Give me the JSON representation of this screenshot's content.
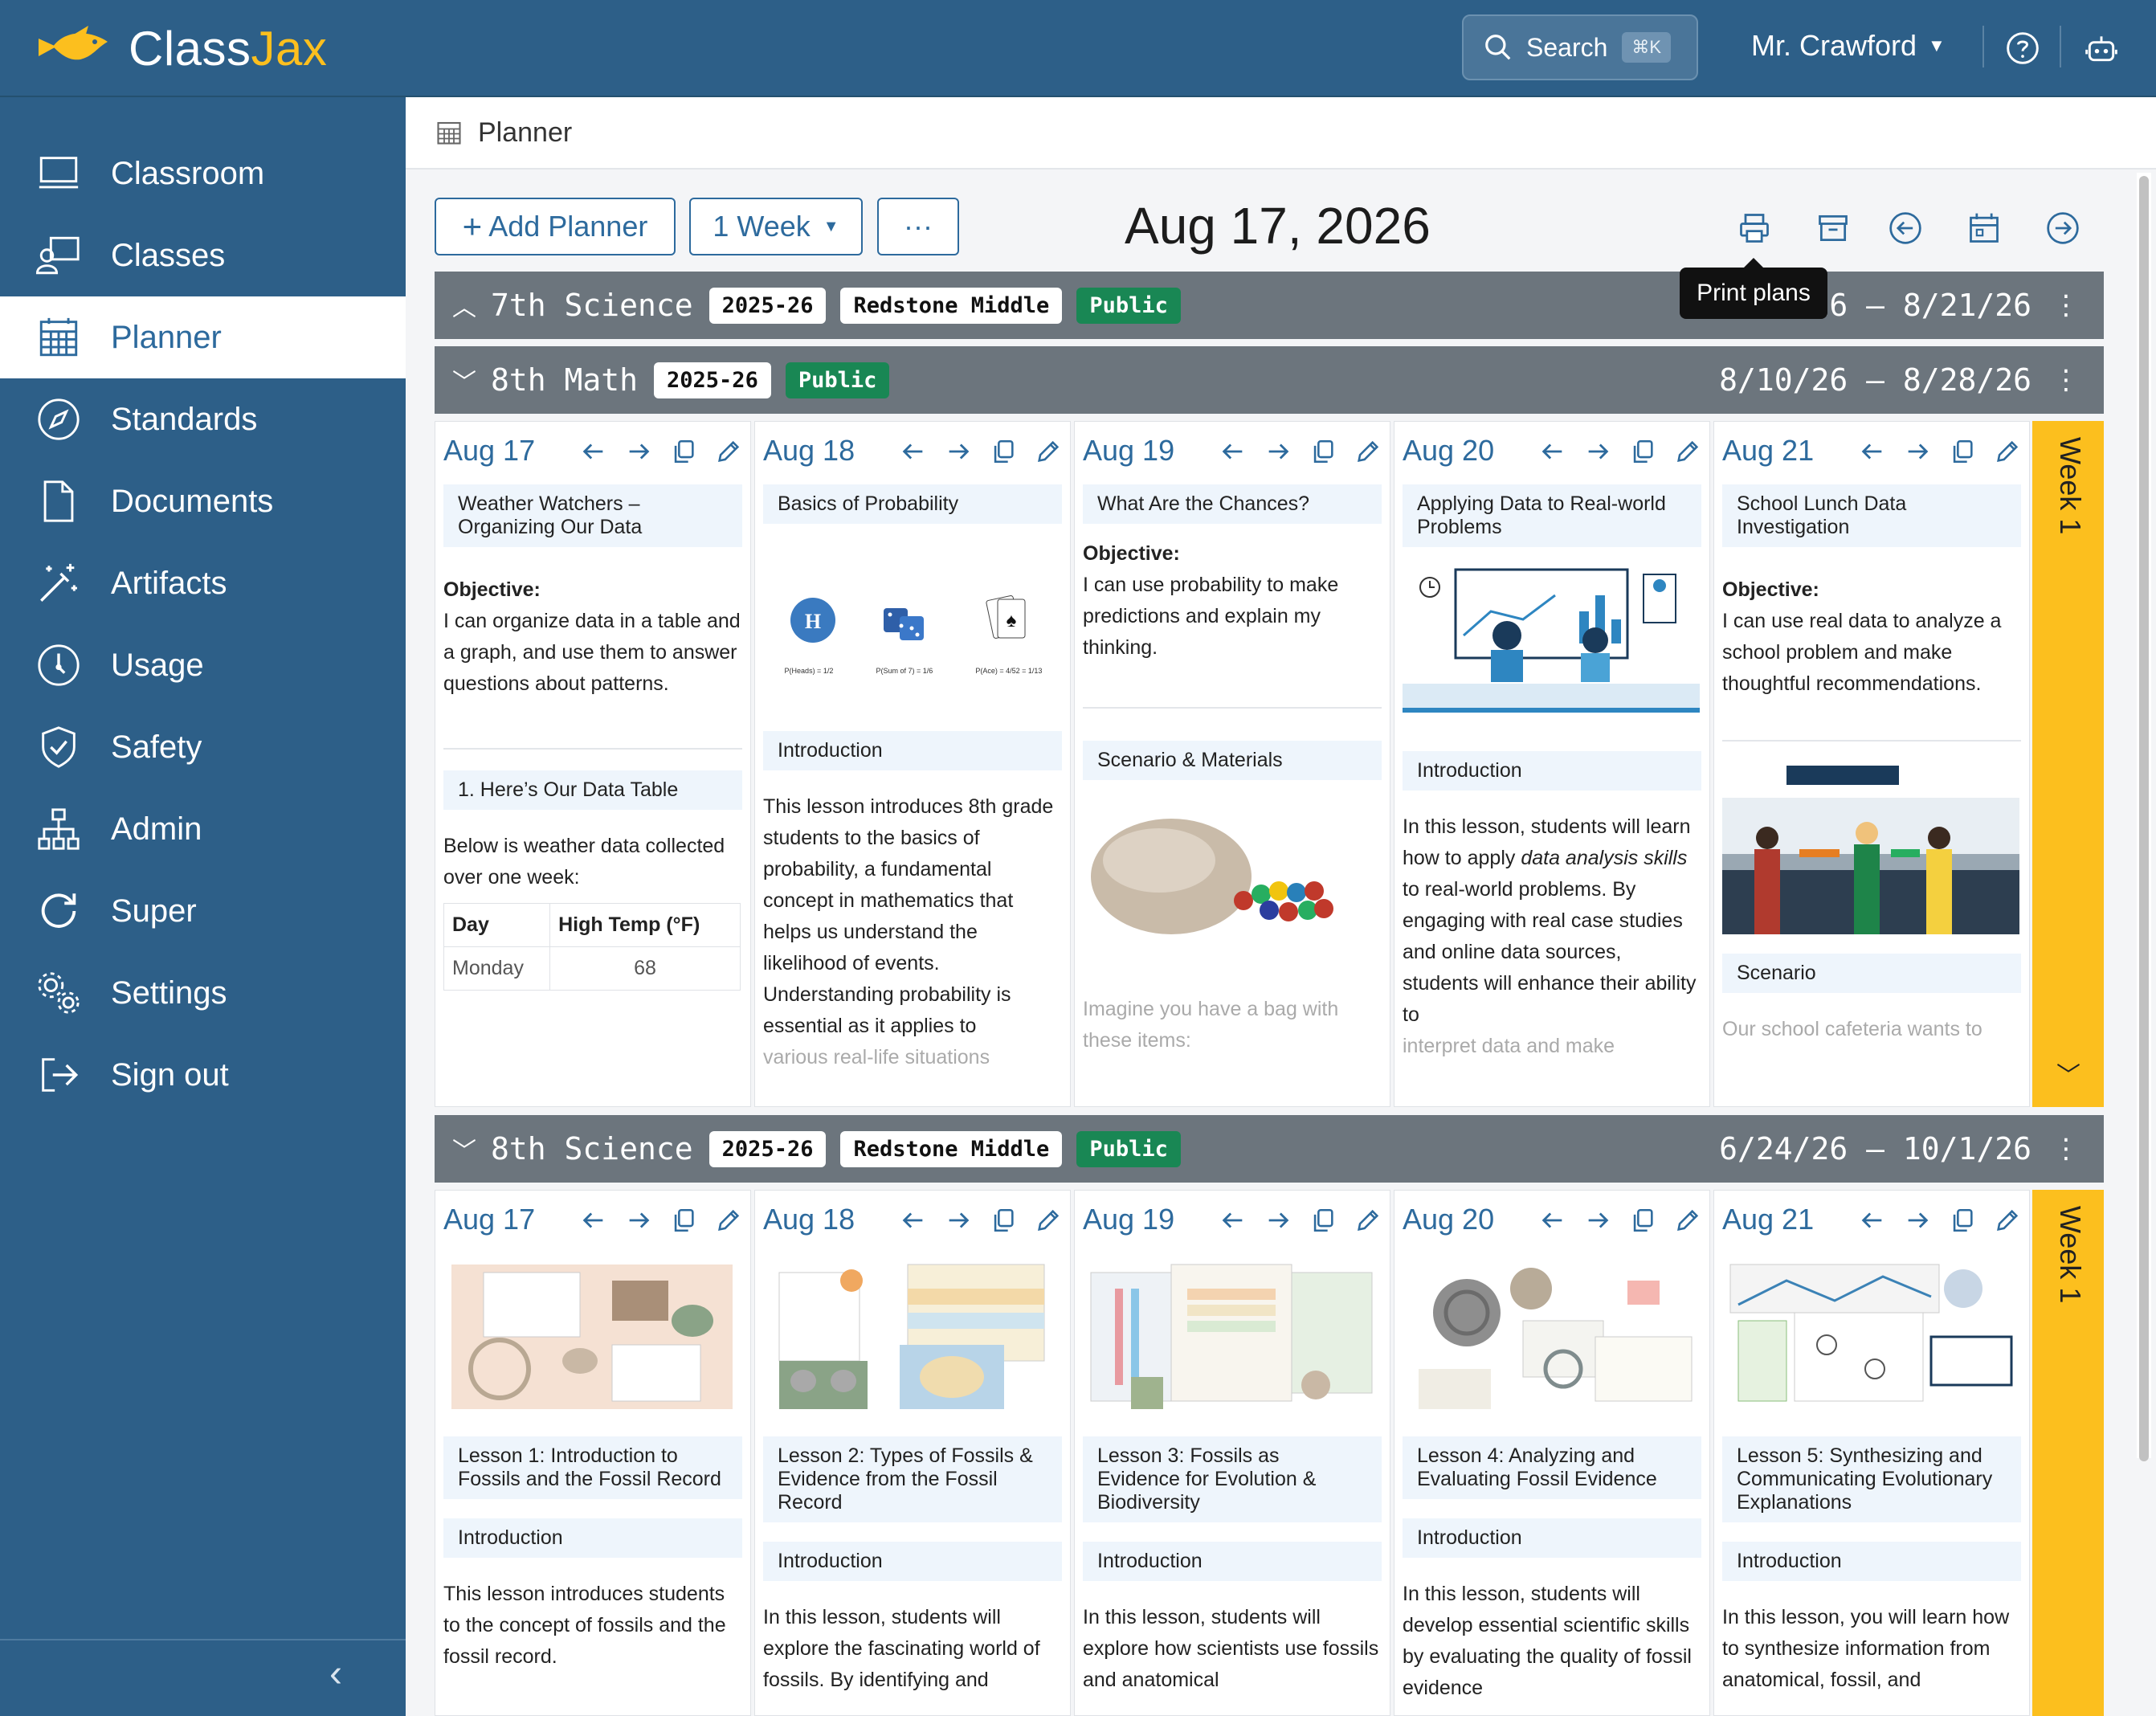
{
  "app": {
    "logo_part1": "Class",
    "logo_part2": "Jax"
  },
  "header": {
    "search_label": "Search",
    "search_shortcut": "⌘K",
    "user_name": "Mr. Crawford"
  },
  "sidebar": {
    "items": [
      {
        "label": "Classroom",
        "icon": "monitor-icon"
      },
      {
        "label": "Classes",
        "icon": "teacher-icon"
      },
      {
        "label": "Planner",
        "icon": "calendar-grid-icon",
        "active": true
      },
      {
        "label": "Standards",
        "icon": "compass-icon"
      },
      {
        "label": "Documents",
        "icon": "document-icon"
      },
      {
        "label": "Artifacts",
        "icon": "magic-wand-icon"
      },
      {
        "label": "Usage",
        "icon": "gauge-icon"
      },
      {
        "label": "Safety",
        "icon": "shield-check-icon"
      },
      {
        "label": "Admin",
        "icon": "org-chart-icon"
      },
      {
        "label": "Super",
        "icon": "refresh-icon"
      },
      {
        "label": "Settings",
        "icon": "gears-icon"
      },
      {
        "label": "Sign out",
        "icon": "sign-out-icon"
      }
    ]
  },
  "breadcrumb": {
    "title": "Planner"
  },
  "toolbar": {
    "add_planner": "Add Planner",
    "add_planner_prefix": "+",
    "range_select": "1 Week",
    "more": "···",
    "date": "Aug 17, 2026",
    "tooltip": "Print plans"
  },
  "planners": [
    {
      "name": "7th Science",
      "year": "2025-26",
      "school": "Redstone Middle",
      "visibility": "Public",
      "range": "8/17/26 – 8/21/26",
      "range_visible": "26 – 8/21/26",
      "expanded": false
    },
    {
      "name": "8th Math",
      "year": "2025-26",
      "visibility": "Public",
      "range": "8/10/26 – 8/28/26",
      "expanded": true
    },
    {
      "name": "8th Science",
      "year": "2025-26",
      "school": "Redstone Middle",
      "visibility": "Public",
      "range": "6/24/26 – 10/1/26",
      "expanded": true
    }
  ],
  "days": [
    "Aug 17",
    "Aug 18",
    "Aug 19",
    "Aug 20",
    "Aug 21"
  ],
  "week_label": "Week 1",
  "math": {
    "d1": {
      "title": "Weather Watchers – Organizing Our Data",
      "obj_label": "Objective:",
      "obj_text": "I can organize data in a table and a graph, and use them to answer questions about patterns.",
      "section": "1. Here’s Our Data Table",
      "body": "Below is weather data collected over one week:",
      "th1": "Day",
      "th2": "High Temp (°F)",
      "row_day": "Monday",
      "row_val": "68"
    },
    "d2": {
      "title": "Basics of Probability",
      "cap1": "P(Heads) = 1/2",
      "cap2": "P(Sum of 7) = 1/6",
      "cap3": "P(Ace) = 4/52 = 1/13",
      "section": "Introduction",
      "body": "This lesson introduces 8th grade students to the basics of probability, a fundamental concept in mathematics that helps us understand the likelihood of events. Understanding probability is essential as it applies to",
      "fade": "various real-life situations"
    },
    "d3": {
      "title": "What Are the Chances?",
      "obj_label": "Objective:",
      "obj_text": "I can use probability to make predictions and explain my thinking.",
      "section": "Scenario & Materials",
      "fade": "Imagine you have a bag with these items:"
    },
    "d4": {
      "title": "Applying Data to Real-world Problems",
      "section": "Introduction",
      "body1": "In this lesson, students will learn how to apply ",
      "body_em": "data analysis skills",
      "body2": " to real-world problems. By engaging with real case studies and online data sources, students will enhance their ability to",
      "fade": "interpret data and make"
    },
    "d5": {
      "title": "School Lunch Data Investigation",
      "obj_label": "Objective:",
      "obj_text": "I can use real data to analyze a school problem and make thoughtful recommendations.",
      "section": "Scenario",
      "fade": "Our school cafeteria wants to"
    }
  },
  "science": {
    "d1": {
      "title": "Lesson 1: Introduction to Fossils and the Fossil Record",
      "section": "Introduction",
      "body": "This lesson introduces students to the concept of fossils and the fossil record."
    },
    "d2": {
      "title": "Lesson 2: Types of Fossils & Evidence from the Fossil Record",
      "section": "Introduction",
      "body": "In this lesson, students will explore the fascinating world of fossils. By identifying and"
    },
    "d3": {
      "title": "Lesson 3: Fossils as Evidence for Evolution & Biodiversity",
      "section": "Introduction",
      "body": "In this lesson, students will explore how scientists use fossils and anatomical"
    },
    "d4": {
      "title": "Lesson 4: Analyzing and Evaluating Fossil Evidence",
      "section": "Introduction",
      "body": "In this lesson, students will develop essential scientific skills by evaluating the quality of fossil evidence"
    },
    "d5": {
      "title": "Lesson 5: Synthesizing and Communicating Evolutionary Explanations",
      "section": "Introduction",
      "body": "In this lesson, you will learn how to synthesize information from anatomical, fossil, and"
    }
  },
  "colors": {
    "brand": "#2d5f88",
    "accent_yellow": "#fcbf1e",
    "public_green": "#198754",
    "bar_gray": "#6c757d"
  }
}
